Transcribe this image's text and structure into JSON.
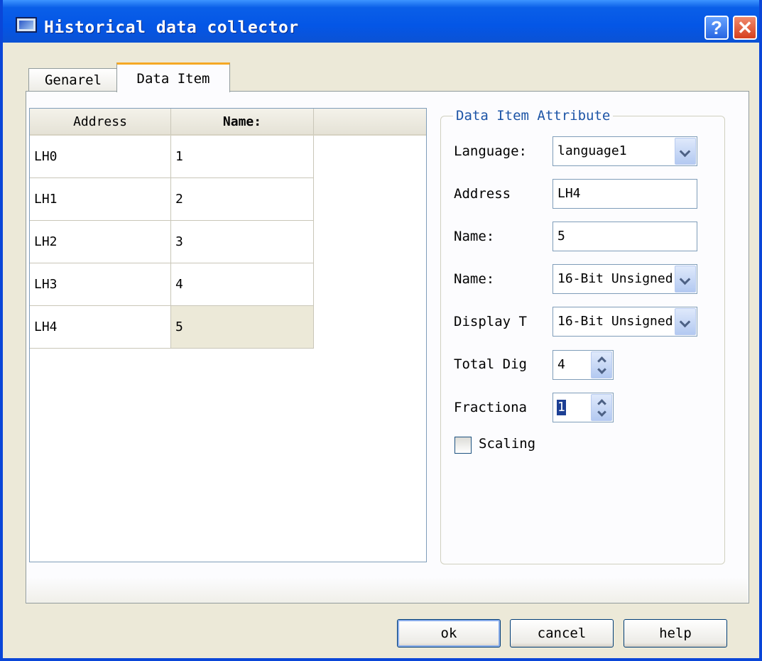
{
  "window": {
    "title": "Historical data collector",
    "help_button": "?",
    "close_button": "✕"
  },
  "tabs": [
    {
      "label": "Genarel",
      "active": false
    },
    {
      "label": "Data Item",
      "active": true
    }
  ],
  "grid": {
    "columns": [
      "Address",
      "Name:"
    ],
    "rows": [
      {
        "address": "LH0",
        "name": "1"
      },
      {
        "address": "LH1",
        "name": "2"
      },
      {
        "address": "LH2",
        "name": "3"
      },
      {
        "address": "LH3",
        "name": "4"
      },
      {
        "address": "LH4",
        "name": "5",
        "selected": true
      }
    ]
  },
  "attributes": {
    "group_title": "Data Item Attribute",
    "language_label": "Language:",
    "language_value": "language1",
    "address_label": "Address",
    "address_value": "LH4",
    "name_label": "Name:",
    "name_value": "5",
    "data_type_label": "Name:",
    "data_type_value": "16-Bit Unsigned",
    "display_type_label": "Display T",
    "display_type_value": "16-Bit Unsigned",
    "total_digits_label": "Total Dig",
    "total_digits_value": "4",
    "fractional_label": "Fractiona",
    "fractional_value": "1",
    "scaling_label": "Scaling",
    "scaling_checked": false
  },
  "buttons": {
    "ok": "ok",
    "cancel": "cancel",
    "help": "help"
  },
  "colors": {
    "titlebar": "#0456e6",
    "dialog_background": "#ece9d8",
    "group_title": "#1c54a6",
    "active_tab_accent": "#f5a825"
  }
}
